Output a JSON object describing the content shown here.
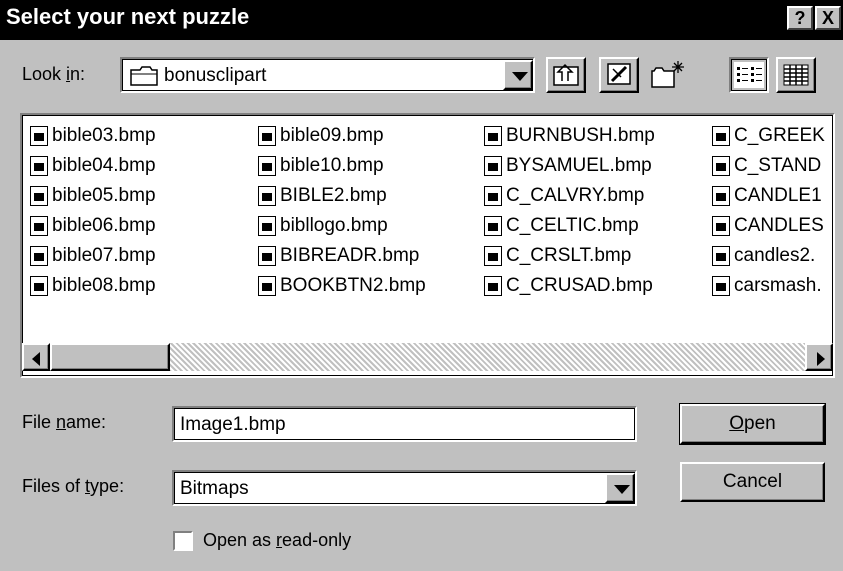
{
  "window": {
    "title": "Select your next puzzle",
    "help_label": "?",
    "close_label": "X"
  },
  "look_in": {
    "label": "Look in:",
    "folder": "bonusclipart",
    "folder_icon": "folder-icon"
  },
  "toolbar": {
    "icons": [
      "up-one-level-icon",
      "desktop-icon",
      "new-folder-icon",
      "list-view-icon",
      "details-view-icon"
    ]
  },
  "files": {
    "columns": [
      [
        "bible03.bmp",
        "bible04.bmp",
        "bible05.bmp",
        "bible06.bmp",
        "bible07.bmp",
        "bible08.bmp"
      ],
      [
        "bible09.bmp",
        "bible10.bmp",
        "BIBLE2.bmp",
        "bibllogo.bmp",
        "BIBREADR.bmp",
        "BOOKBTN2.bmp"
      ],
      [
        "BURNBUSH.bmp",
        "BYSAMUEL.bmp",
        "C_CALVRY.bmp",
        "C_CELTIC.bmp",
        "C_CRSLT.bmp",
        "C_CRUSAD.bmp"
      ],
      [
        "C_GREEK",
        "C_STAND",
        "CANDLE1",
        "CANDLES",
        "candles2.",
        "carsmash."
      ]
    ]
  },
  "file_name": {
    "label": "File name:",
    "value": "Image1.bmp"
  },
  "file_type": {
    "label": "Files of type:",
    "value": "Bitmaps"
  },
  "buttons": {
    "open": "Open",
    "cancel": "Cancel"
  },
  "read_only": {
    "label": "Open as read-only",
    "checked": false
  }
}
